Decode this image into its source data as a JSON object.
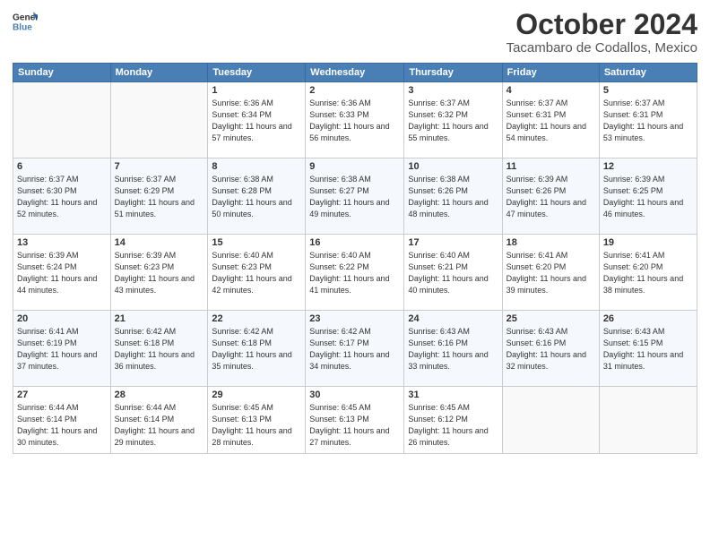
{
  "header": {
    "logo_line1": "General",
    "logo_line2": "Blue",
    "month_year": "October 2024",
    "location": "Tacambaro de Codallos, Mexico"
  },
  "weekdays": [
    "Sunday",
    "Monday",
    "Tuesday",
    "Wednesday",
    "Thursday",
    "Friday",
    "Saturday"
  ],
  "weeks": [
    [
      {
        "day": "",
        "info": ""
      },
      {
        "day": "",
        "info": ""
      },
      {
        "day": "1",
        "info": "Sunrise: 6:36 AM\nSunset: 6:34 PM\nDaylight: 11 hours and 57 minutes."
      },
      {
        "day": "2",
        "info": "Sunrise: 6:36 AM\nSunset: 6:33 PM\nDaylight: 11 hours and 56 minutes."
      },
      {
        "day": "3",
        "info": "Sunrise: 6:37 AM\nSunset: 6:32 PM\nDaylight: 11 hours and 55 minutes."
      },
      {
        "day": "4",
        "info": "Sunrise: 6:37 AM\nSunset: 6:31 PM\nDaylight: 11 hours and 54 minutes."
      },
      {
        "day": "5",
        "info": "Sunrise: 6:37 AM\nSunset: 6:31 PM\nDaylight: 11 hours and 53 minutes."
      }
    ],
    [
      {
        "day": "6",
        "info": "Sunrise: 6:37 AM\nSunset: 6:30 PM\nDaylight: 11 hours and 52 minutes."
      },
      {
        "day": "7",
        "info": "Sunrise: 6:37 AM\nSunset: 6:29 PM\nDaylight: 11 hours and 51 minutes."
      },
      {
        "day": "8",
        "info": "Sunrise: 6:38 AM\nSunset: 6:28 PM\nDaylight: 11 hours and 50 minutes."
      },
      {
        "day": "9",
        "info": "Sunrise: 6:38 AM\nSunset: 6:27 PM\nDaylight: 11 hours and 49 minutes."
      },
      {
        "day": "10",
        "info": "Sunrise: 6:38 AM\nSunset: 6:26 PM\nDaylight: 11 hours and 48 minutes."
      },
      {
        "day": "11",
        "info": "Sunrise: 6:39 AM\nSunset: 6:26 PM\nDaylight: 11 hours and 47 minutes."
      },
      {
        "day": "12",
        "info": "Sunrise: 6:39 AM\nSunset: 6:25 PM\nDaylight: 11 hours and 46 minutes."
      }
    ],
    [
      {
        "day": "13",
        "info": "Sunrise: 6:39 AM\nSunset: 6:24 PM\nDaylight: 11 hours and 44 minutes."
      },
      {
        "day": "14",
        "info": "Sunrise: 6:39 AM\nSunset: 6:23 PM\nDaylight: 11 hours and 43 minutes."
      },
      {
        "day": "15",
        "info": "Sunrise: 6:40 AM\nSunset: 6:23 PM\nDaylight: 11 hours and 42 minutes."
      },
      {
        "day": "16",
        "info": "Sunrise: 6:40 AM\nSunset: 6:22 PM\nDaylight: 11 hours and 41 minutes."
      },
      {
        "day": "17",
        "info": "Sunrise: 6:40 AM\nSunset: 6:21 PM\nDaylight: 11 hours and 40 minutes."
      },
      {
        "day": "18",
        "info": "Sunrise: 6:41 AM\nSunset: 6:20 PM\nDaylight: 11 hours and 39 minutes."
      },
      {
        "day": "19",
        "info": "Sunrise: 6:41 AM\nSunset: 6:20 PM\nDaylight: 11 hours and 38 minutes."
      }
    ],
    [
      {
        "day": "20",
        "info": "Sunrise: 6:41 AM\nSunset: 6:19 PM\nDaylight: 11 hours and 37 minutes."
      },
      {
        "day": "21",
        "info": "Sunrise: 6:42 AM\nSunset: 6:18 PM\nDaylight: 11 hours and 36 minutes."
      },
      {
        "day": "22",
        "info": "Sunrise: 6:42 AM\nSunset: 6:18 PM\nDaylight: 11 hours and 35 minutes."
      },
      {
        "day": "23",
        "info": "Sunrise: 6:42 AM\nSunset: 6:17 PM\nDaylight: 11 hours and 34 minutes."
      },
      {
        "day": "24",
        "info": "Sunrise: 6:43 AM\nSunset: 6:16 PM\nDaylight: 11 hours and 33 minutes."
      },
      {
        "day": "25",
        "info": "Sunrise: 6:43 AM\nSunset: 6:16 PM\nDaylight: 11 hours and 32 minutes."
      },
      {
        "day": "26",
        "info": "Sunrise: 6:43 AM\nSunset: 6:15 PM\nDaylight: 11 hours and 31 minutes."
      }
    ],
    [
      {
        "day": "27",
        "info": "Sunrise: 6:44 AM\nSunset: 6:14 PM\nDaylight: 11 hours and 30 minutes."
      },
      {
        "day": "28",
        "info": "Sunrise: 6:44 AM\nSunset: 6:14 PM\nDaylight: 11 hours and 29 minutes."
      },
      {
        "day": "29",
        "info": "Sunrise: 6:45 AM\nSunset: 6:13 PM\nDaylight: 11 hours and 28 minutes."
      },
      {
        "day": "30",
        "info": "Sunrise: 6:45 AM\nSunset: 6:13 PM\nDaylight: 11 hours and 27 minutes."
      },
      {
        "day": "31",
        "info": "Sunrise: 6:45 AM\nSunset: 6:12 PM\nDaylight: 11 hours and 26 minutes."
      },
      {
        "day": "",
        "info": ""
      },
      {
        "day": "",
        "info": ""
      }
    ]
  ]
}
